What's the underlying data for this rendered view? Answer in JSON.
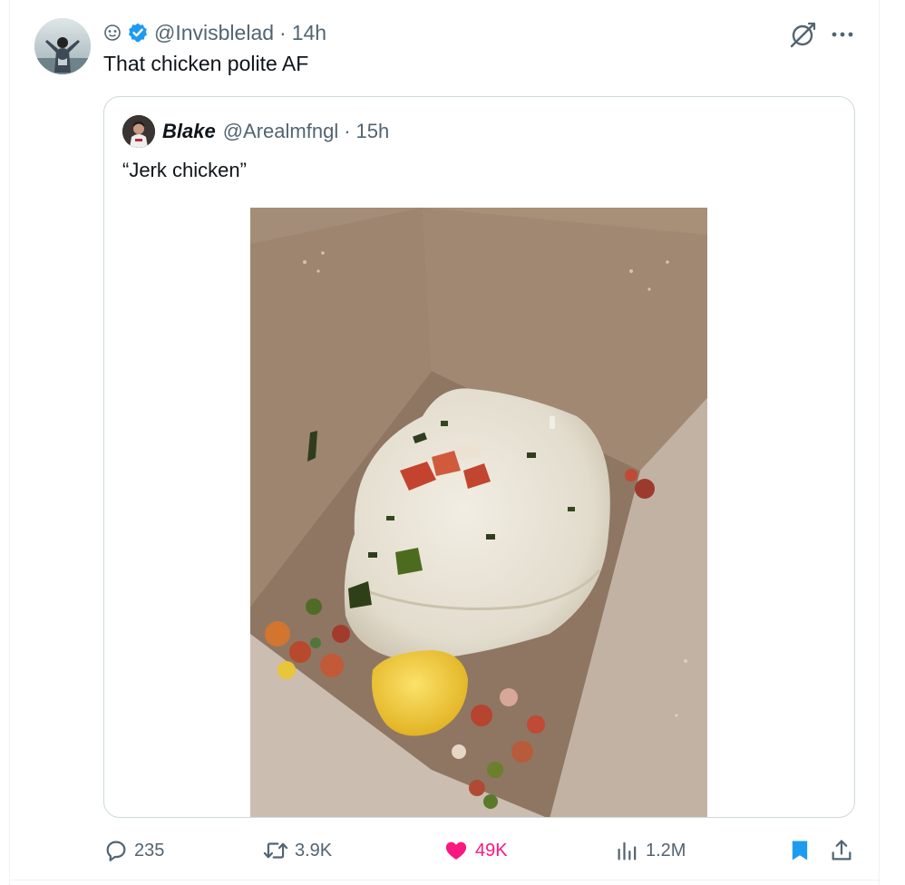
{
  "post": {
    "handle": "@Invisblelad",
    "separator": "·",
    "time": "14h",
    "text": "That chicken polite AF"
  },
  "quoted": {
    "name": "Blake",
    "handle": "@Arealmfngl",
    "separator": "·",
    "time": "15h",
    "text": "“Jerk chicken”"
  },
  "actions": {
    "replies": "235",
    "reposts": "3.9K",
    "likes": "49K",
    "views": "1.2M"
  },
  "colors": {
    "verified": "#1d9bf0",
    "like": "#f91880",
    "bookmark": "#1d9bf0",
    "muted": "#536471",
    "border": "#cfd9de"
  },
  "icons": [
    "smiley-emoji-icon",
    "verified-badge-icon",
    "grok-icon",
    "more-icon",
    "reply-icon",
    "repost-icon",
    "like-icon",
    "views-icon",
    "bookmark-icon",
    "share-icon"
  ]
}
